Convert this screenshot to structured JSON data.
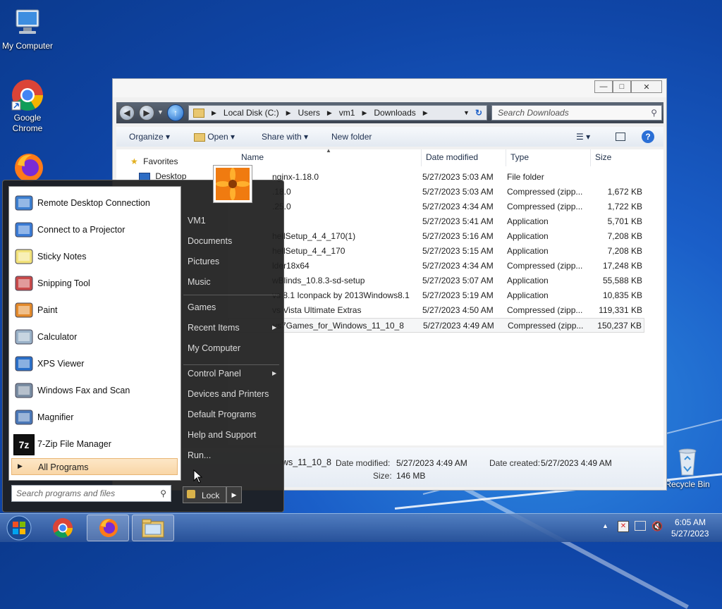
{
  "desktop": {
    "icons": [
      {
        "label": "My Computer"
      },
      {
        "label": "Google Chrome"
      },
      {
        "label": "Recycle Bin"
      }
    ]
  },
  "explorer": {
    "breadcrumbs": [
      "Local Disk (C:)",
      "Users",
      "vm1",
      "Downloads"
    ],
    "search_placeholder": "Search Downloads",
    "toolbar": {
      "organize": "Organize",
      "open": "Open",
      "share_with": "Share with",
      "new_folder": "New folder"
    },
    "nav": {
      "favorites": "Favorites",
      "desktop": "Desktop"
    },
    "columns": {
      "name": "Name",
      "date": "Date modified",
      "type": "Type",
      "size": "Size"
    },
    "rows": [
      {
        "name": "nginx-1.18.0",
        "date": "5/27/2023 5:03 AM",
        "type": "File folder",
        "size": ""
      },
      {
        "name": ".18.0",
        "date": "5/27/2023 5:03 AM",
        "type": "Compressed (zipp...",
        "size": "1,672 KB"
      },
      {
        "name": ".25.0",
        "date": "5/27/2023 4:34 AM",
        "type": "Compressed (zipp...",
        "size": "1,722 KB"
      },
      {
        "name": "",
        "date": "5/27/2023 5:41 AM",
        "type": "Application",
        "size": "5,701 KB"
      },
      {
        "name": "hellSetup_4_4_170(1)",
        "date": "5/27/2023 5:16 AM",
        "type": "Application",
        "size": "7,208 KB"
      },
      {
        "name": "hellSetup_4_4_170",
        "date": "5/27/2023 5:15 AM",
        "type": "Application",
        "size": "7,208 KB"
      },
      {
        "name": "lder18x64",
        "date": "5/27/2023 4:34 AM",
        "type": "Compressed (zipp...",
        "size": "17,248 KB"
      },
      {
        "name": "wBlinds_10.8.3-sd-setup",
        "date": "5/27/2023 5:07 AM",
        "type": "Application",
        "size": "55,588 KB"
      },
      {
        "name": "vs 8.1 Iconpack by 2013Windows8.1",
        "date": "5/27/2023 5:19 AM",
        "type": "Application",
        "size": "10,835 KB"
      },
      {
        "name": "vs Vista Ultimate Extras",
        "date": "5/27/2023 4:50 AM",
        "type": "Compressed (zipp...",
        "size": "119,331 KB"
      },
      {
        "name": "vs7Games_for_Windows_11_10_8",
        "date": "5/27/2023 4:49 AM",
        "type": "Compressed (zipp...",
        "size": "150,237 KB"
      }
    ],
    "details": {
      "name": "ws_11_10_8",
      "modified_label": "Date modified:",
      "modified": "5/27/2023 4:49 AM",
      "created_label": "Date created:",
      "created": "5/27/2023 4:49 AM",
      "size_label": "Size:",
      "size": "146 MB"
    }
  },
  "startmenu": {
    "programs": [
      {
        "label": "Remote Desktop Connection",
        "icon": "remote-desktop-icon"
      },
      {
        "label": "Connect to a Projector",
        "icon": "projector-icon"
      },
      {
        "label": "Sticky Notes",
        "icon": "sticky-notes-icon"
      },
      {
        "label": "Snipping Tool",
        "icon": "snipping-tool-icon"
      },
      {
        "label": "Paint",
        "icon": "paint-icon"
      },
      {
        "label": "Calculator",
        "icon": "calculator-icon"
      },
      {
        "label": "XPS Viewer",
        "icon": "xps-viewer-icon"
      },
      {
        "label": "Windows Fax and Scan",
        "icon": "fax-scan-icon"
      },
      {
        "label": "Magnifier",
        "icon": "magnifier-icon"
      },
      {
        "label": "7-Zip File Manager",
        "icon": "seven-zip-icon"
      }
    ],
    "all_programs": "All Programs",
    "search_placeholder": "Search programs and files",
    "right_items": [
      {
        "label": "VM1"
      },
      {
        "label": "Documents"
      },
      {
        "label": "Pictures"
      },
      {
        "label": "Music"
      },
      {
        "label": "Games"
      },
      {
        "label": "Recent Items"
      },
      {
        "label": "My Computer"
      },
      {
        "label": "Control Panel"
      },
      {
        "label": "Devices and Printers"
      },
      {
        "label": "Default Programs"
      },
      {
        "label": "Help and Support"
      },
      {
        "label": "Run..."
      }
    ],
    "lock_label": "Lock"
  },
  "taskbar": {
    "time": "6:05 AM",
    "date": "5/27/2023"
  },
  "colors": {
    "accent": "#1a5ec8",
    "start_bg": "#1e1e1e",
    "highlight": "#f9d6a6"
  }
}
